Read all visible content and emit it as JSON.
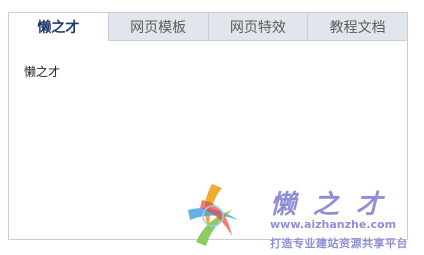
{
  "tabs": [
    {
      "label": "懒之才",
      "active": true
    },
    {
      "label": "网页模板",
      "active": false
    },
    {
      "label": "网页特效",
      "active": false
    },
    {
      "label": "教程文档",
      "active": false
    }
  ],
  "panel": {
    "content": "懒之才"
  },
  "watermark": {
    "logo_icon": "star-swirl-logo",
    "title": "懒之才",
    "url": "www.aizhanzhe.com",
    "slogan": "打造专业建站资源共享平台",
    "color": "#8f8fd8"
  },
  "colors": {
    "tab_bar_bg": "#e1e5ec",
    "active_tab_text": "#1e3a6e",
    "border": "#c9ced6"
  }
}
